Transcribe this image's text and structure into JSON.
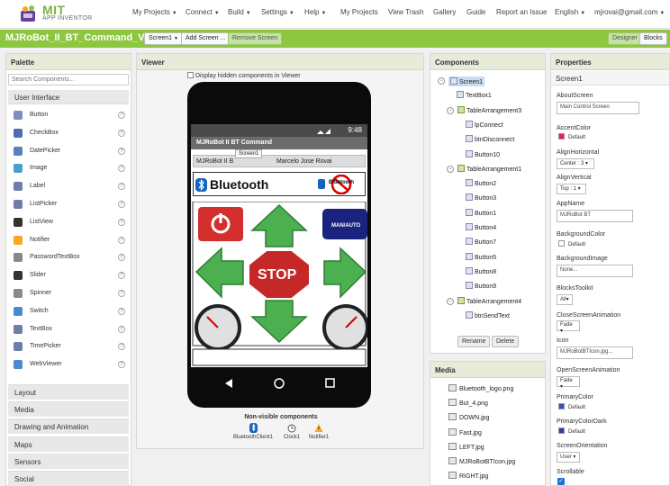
{
  "brand": {
    "name": "MIT",
    "sub": "APP INVENTOR",
    "green": "#8dc63f",
    "icon": "app-inventor-logo-icon"
  },
  "topnav": [
    {
      "label": "My Projects",
      "dropdown": true
    },
    {
      "label": "Connect",
      "dropdown": true
    },
    {
      "label": "Build",
      "dropdown": true
    },
    {
      "label": "Settings",
      "dropdown": true
    },
    {
      "label": "Help",
      "dropdown": true
    },
    {
      "label": "My Projects",
      "dropdown": false
    },
    {
      "label": "View Trash",
      "dropdown": false
    },
    {
      "label": "Gallery",
      "dropdown": false
    },
    {
      "label": "Guide",
      "dropdown": false
    },
    {
      "label": "Report an Issue",
      "dropdown": false
    },
    {
      "label": "English",
      "dropdown": true
    },
    {
      "label": "mjrovai@gmail.com",
      "dropdown": true
    }
  ],
  "project": {
    "title": "MJRoBot_II_BT_Command_V2",
    "screen_select": "Screen1",
    "add_screen": "Add Screen ...",
    "remove_screen": "Remove Screen",
    "designer": "Designer",
    "blocks": "Blocks"
  },
  "palette": {
    "title": "Palette",
    "search_placeholder": "Search Components...",
    "active_category": "User Interface",
    "items": [
      {
        "label": "Button",
        "icon": "button-icon"
      },
      {
        "label": "CheckBox",
        "icon": "checkbox-icon"
      },
      {
        "label": "DatePicker",
        "icon": "datepicker-icon"
      },
      {
        "label": "Image",
        "icon": "image-icon"
      },
      {
        "label": "Label",
        "icon": "label-icon"
      },
      {
        "label": "ListPicker",
        "icon": "listpicker-icon"
      },
      {
        "label": "ListView",
        "icon": "listview-icon"
      },
      {
        "label": "Notifier",
        "icon": "notifier-icon"
      },
      {
        "label": "PasswordTextBox",
        "icon": "password-icon"
      },
      {
        "label": "Slider",
        "icon": "slider-icon"
      },
      {
        "label": "Spinner",
        "icon": "spinner-icon"
      },
      {
        "label": "Switch",
        "icon": "switch-icon"
      },
      {
        "label": "TextBox",
        "icon": "textbox-icon"
      },
      {
        "label": "TimePicker",
        "icon": "timepicker-icon"
      },
      {
        "label": "WebViewer",
        "icon": "webviewer-icon"
      }
    ],
    "categories": [
      "Layout",
      "Media",
      "Drawing and Animation",
      "Maps",
      "Sensors",
      "Social"
    ]
  },
  "viewer": {
    "title": "Viewer",
    "hidden_label": "Display hidden components in Viewer",
    "phone": {
      "time": "9:48",
      "app_title": "MJRoBot II BT Command",
      "screen_tip": "Screen1",
      "info_left": "MJRoBot II B",
      "info_right": "Marcelo Jose Rovai",
      "bluetooth_word": "Bluetooth",
      "bluetooth_small": "Bluetooth",
      "man_auto": "MAN/AUTO",
      "stop": "STOP"
    },
    "nonvisible_title": "Non-visible components",
    "nonvisible": [
      "BluetoothClient1",
      "Clock1",
      "Notifier1"
    ]
  },
  "components": {
    "title": "Components",
    "tree": [
      {
        "label": "Screen1",
        "kind": "screen",
        "selected": true,
        "toggle": "−"
      },
      {
        "label": "TextBox1",
        "kind": "leaf"
      },
      {
        "label": "TableArrangement3",
        "kind": "arr",
        "toggle": "−"
      },
      {
        "label": "lpConnect",
        "kind": "leaf"
      },
      {
        "label": "btnDisconnect",
        "kind": "leaf"
      },
      {
        "label": "Button10",
        "kind": "leaf"
      },
      {
        "label": "TableArrangement1",
        "kind": "arr",
        "toggle": "−"
      },
      {
        "label": "Button2",
        "kind": "leaf"
      },
      {
        "label": "Button3",
        "kind": "leaf"
      },
      {
        "label": "Button1",
        "kind": "leaf"
      },
      {
        "label": "Button4",
        "kind": "leaf"
      },
      {
        "label": "Button7",
        "kind": "leaf"
      },
      {
        "label": "Button5",
        "kind": "leaf"
      },
      {
        "label": "Button8",
        "kind": "leaf"
      },
      {
        "label": "Button9",
        "kind": "leaf"
      },
      {
        "label": "TableArrangement4",
        "kind": "arr",
        "toggle": "−"
      },
      {
        "label": "btnSendText",
        "kind": "leaf"
      }
    ],
    "rename": "Rename",
    "delete": "Delete"
  },
  "media": {
    "title": "Media",
    "files": [
      "Bluetooth_logo.png",
      "But_4.png",
      "DOWN.jpg",
      "Fast.jpg",
      "LEFT.jpg",
      "MJRoBotBTIcon.jpg",
      "RIGHT.jpg"
    ]
  },
  "properties": {
    "title": "Properties",
    "component": "Screen1",
    "about_label": "AboutScreen",
    "about_value": "Main Control Screen",
    "accent_label": "AccentColor",
    "accent_value": "Default",
    "accent_color": "#e91e63",
    "halign_label": "AlignHorizontal",
    "halign_value": "Center : 3",
    "valign_label": "AlignVertical",
    "valign_value": "Top : 1",
    "appname_label": "AppName",
    "appname_value": "MJRoBot BT",
    "bg_label": "BackgroundColor",
    "bg_value": "Default",
    "bg_color": "#ffffff",
    "bgimg_label": "BackgroundImage",
    "bgimg_value": "None...",
    "blocks_label": "BlocksToolkit",
    "blocks_value": "All",
    "close_anim_label": "CloseScreenAnimation",
    "close_anim_value": "Fade",
    "icon_label": "Icon",
    "icon_value": "MJRoBotBTIcon.jpg...",
    "open_anim_label": "OpenScreenAnimation",
    "open_anim_value": "Fade",
    "primary_label": "PrimaryColor",
    "primary_value": "Default",
    "primary_color": "#3f51b5",
    "primary_dark_label": "PrimaryColorDark",
    "primary_dark_value": "Default",
    "primary_dark_color": "#303f9f",
    "orientation_label": "ScreenOrientation",
    "orientation_value": "User",
    "scrollable_label": "Scrollable",
    "scrollable_checked": true
  }
}
